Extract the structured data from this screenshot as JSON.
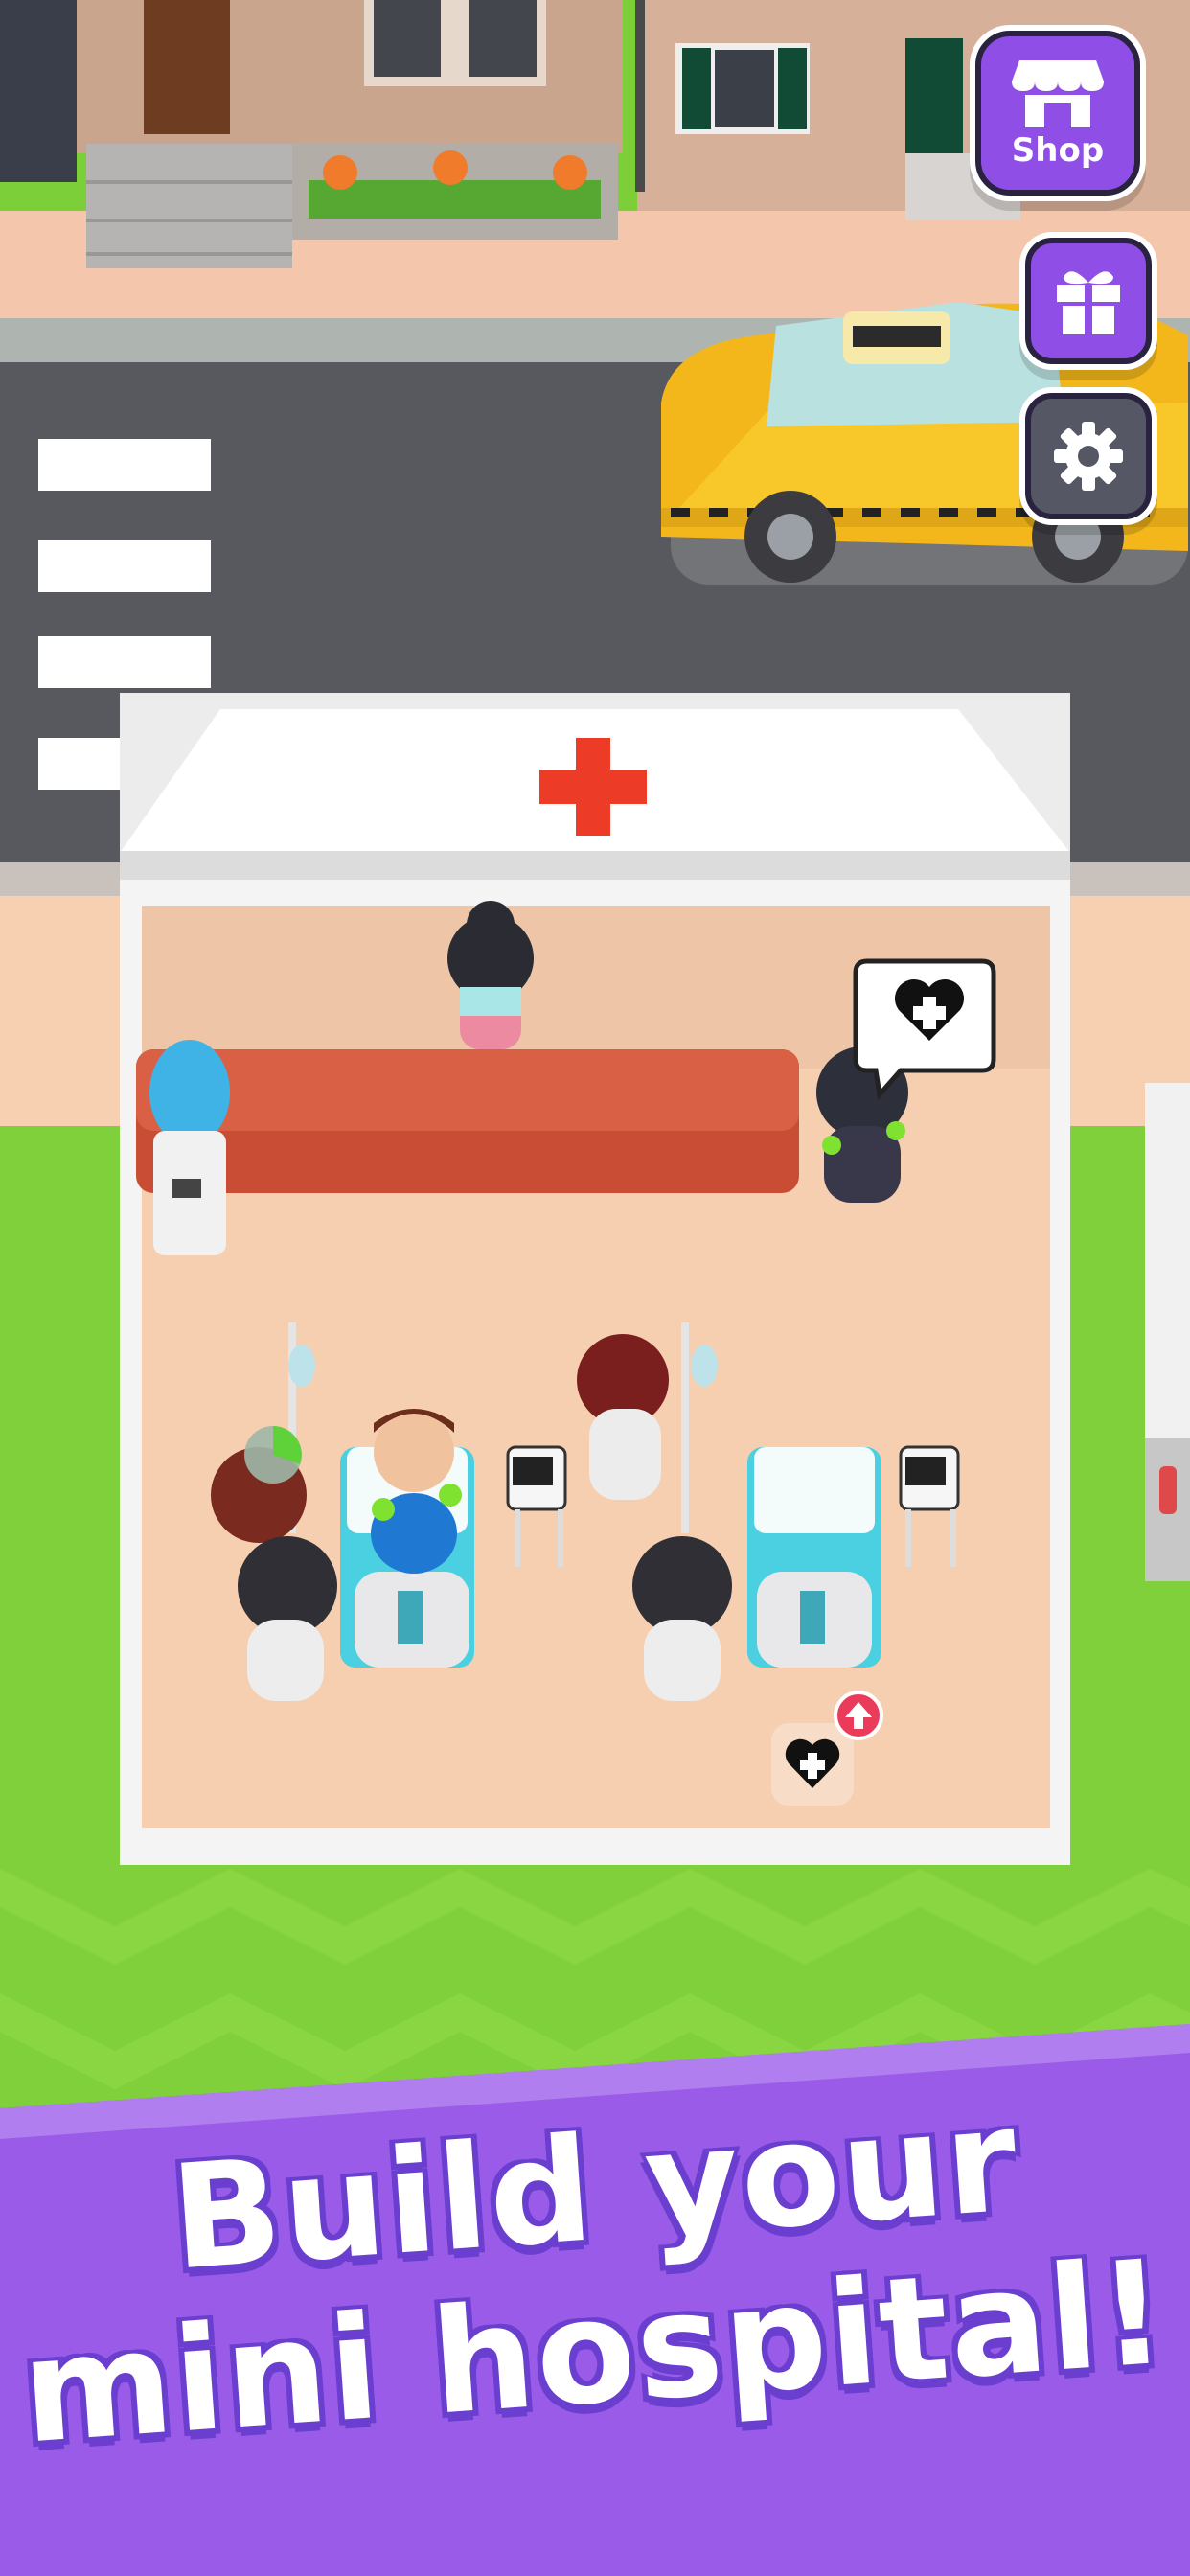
{
  "hud": {
    "shop_label": "Shop",
    "shop_icon": "storefront-icon",
    "gift_icon": "gift-icon",
    "settings_icon": "gear-icon",
    "accent_color": "#8f4fe6"
  },
  "scene": {
    "hospital_sign_icon": "red-cross-icon",
    "bubble_icon": "heart-plus-icon",
    "upgrade_icon": "heart-plus-icon",
    "upgrade_badge_icon": "arrow-up-icon"
  },
  "banner": {
    "line1": "Build your",
    "line2": "mini hospital!",
    "color": "#9a5ce8"
  }
}
